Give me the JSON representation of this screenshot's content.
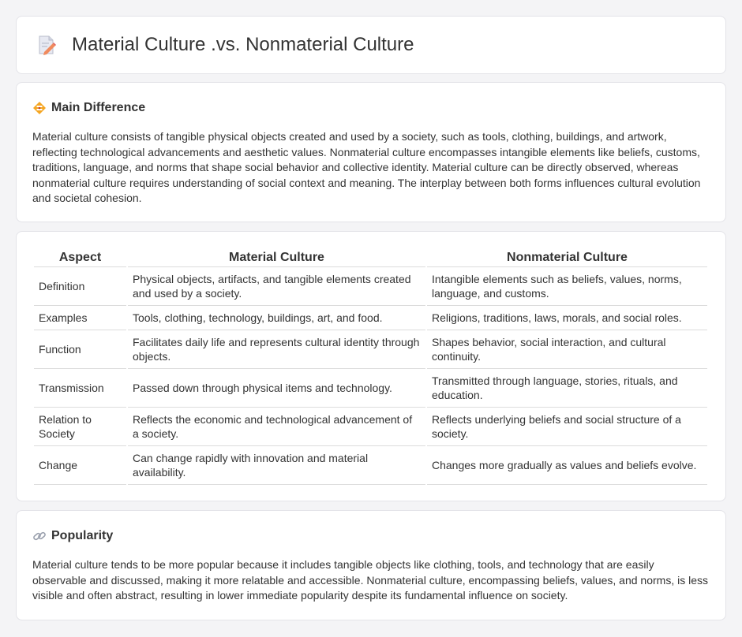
{
  "page": {
    "title": "Material Culture .vs. Nonmaterial Culture"
  },
  "icons": {
    "title": "document-pencil-icon",
    "main": "warning-diamond-icon",
    "popularity": "link-icon"
  },
  "main_difference": {
    "heading": "Main Difference",
    "text": "Material culture consists of tangible physical objects created and used by a society, such as tools, clothing, buildings, and artwork, reflecting technological advancements and aesthetic values. Nonmaterial culture encompasses intangible elements like beliefs, customs, traditions, language, and norms that shape social behavior and collective identity. Material culture can be directly observed, whereas nonmaterial culture requires understanding of social context and meaning. The interplay between both forms influences cultural evolution and societal cohesion."
  },
  "comparison": {
    "headers": [
      "Aspect",
      "Material Culture",
      "Nonmaterial Culture"
    ],
    "rows": [
      [
        "Definition",
        "Physical objects, artifacts, and tangible elements created and used by a society.",
        "Intangible elements such as beliefs, values, norms, language, and customs."
      ],
      [
        "Examples",
        "Tools, clothing, technology, buildings, art, and food.",
        "Religions, traditions, laws, morals, and social roles."
      ],
      [
        "Function",
        "Facilitates daily life and represents cultural identity through objects.",
        "Shapes behavior, social interaction, and cultural continuity."
      ],
      [
        "Transmission",
        "Passed down through physical items and technology.",
        "Transmitted through language, stories, rituals, and education."
      ],
      [
        "Relation to Society",
        "Reflects the economic and technological advancement of a society.",
        "Reflects underlying beliefs and social structure of a society."
      ],
      [
        "Change",
        "Can change rapidly with innovation and material availability.",
        "Changes more gradually as values and beliefs evolve."
      ]
    ]
  },
  "popularity": {
    "heading": "Popularity",
    "text": "Material culture tends to be more popular because it includes tangible objects like clothing, tools, and technology that are easily observable and discussed, making it more relatable and accessible. Nonmaterial culture, encompassing beliefs, values, and norms, is less visible and often abstract, resulting in lower immediate popularity despite its fundamental influence on society."
  }
}
